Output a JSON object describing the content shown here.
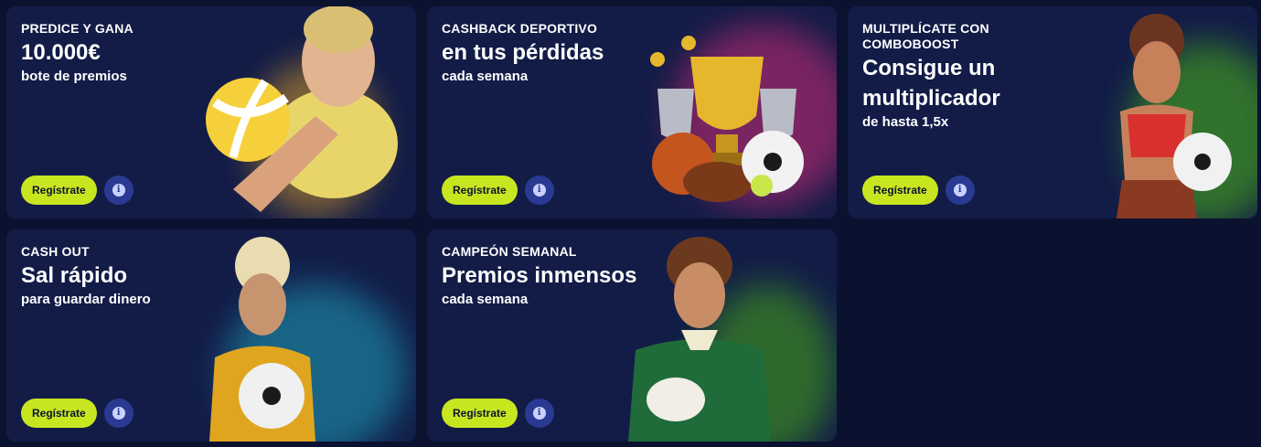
{
  "cards": [
    {
      "eyebrow": "PREDICE Y GANA",
      "headline": "10.000€",
      "sub": "bote de premios",
      "button": "Regístrate"
    },
    {
      "eyebrow": "CASHBACK DEPORTIVO",
      "headline": "en tus pérdidas",
      "sub": "cada semana",
      "button": "Regístrate"
    },
    {
      "eyebrow": "MULTIPLÍCATE CON COMBOBOOST",
      "headline": "Consigue un multiplicador",
      "sub": "de hasta 1,5x",
      "button": "Regístrate"
    },
    {
      "eyebrow": "CASH OUT",
      "headline": "Sal rápido",
      "sub": "para guardar dinero",
      "button": "Regístrate"
    },
    {
      "eyebrow": "CAMPEÓN SEMANAL",
      "headline": "Premios inmensos",
      "sub": "cada semana",
      "button": "Regístrate"
    }
  ],
  "info_glyph": "i",
  "colors": {
    "page_bg": "#0b1230",
    "card_bg": "#121c47",
    "button": "#c8e620",
    "info_bg": "#2a3a92"
  }
}
